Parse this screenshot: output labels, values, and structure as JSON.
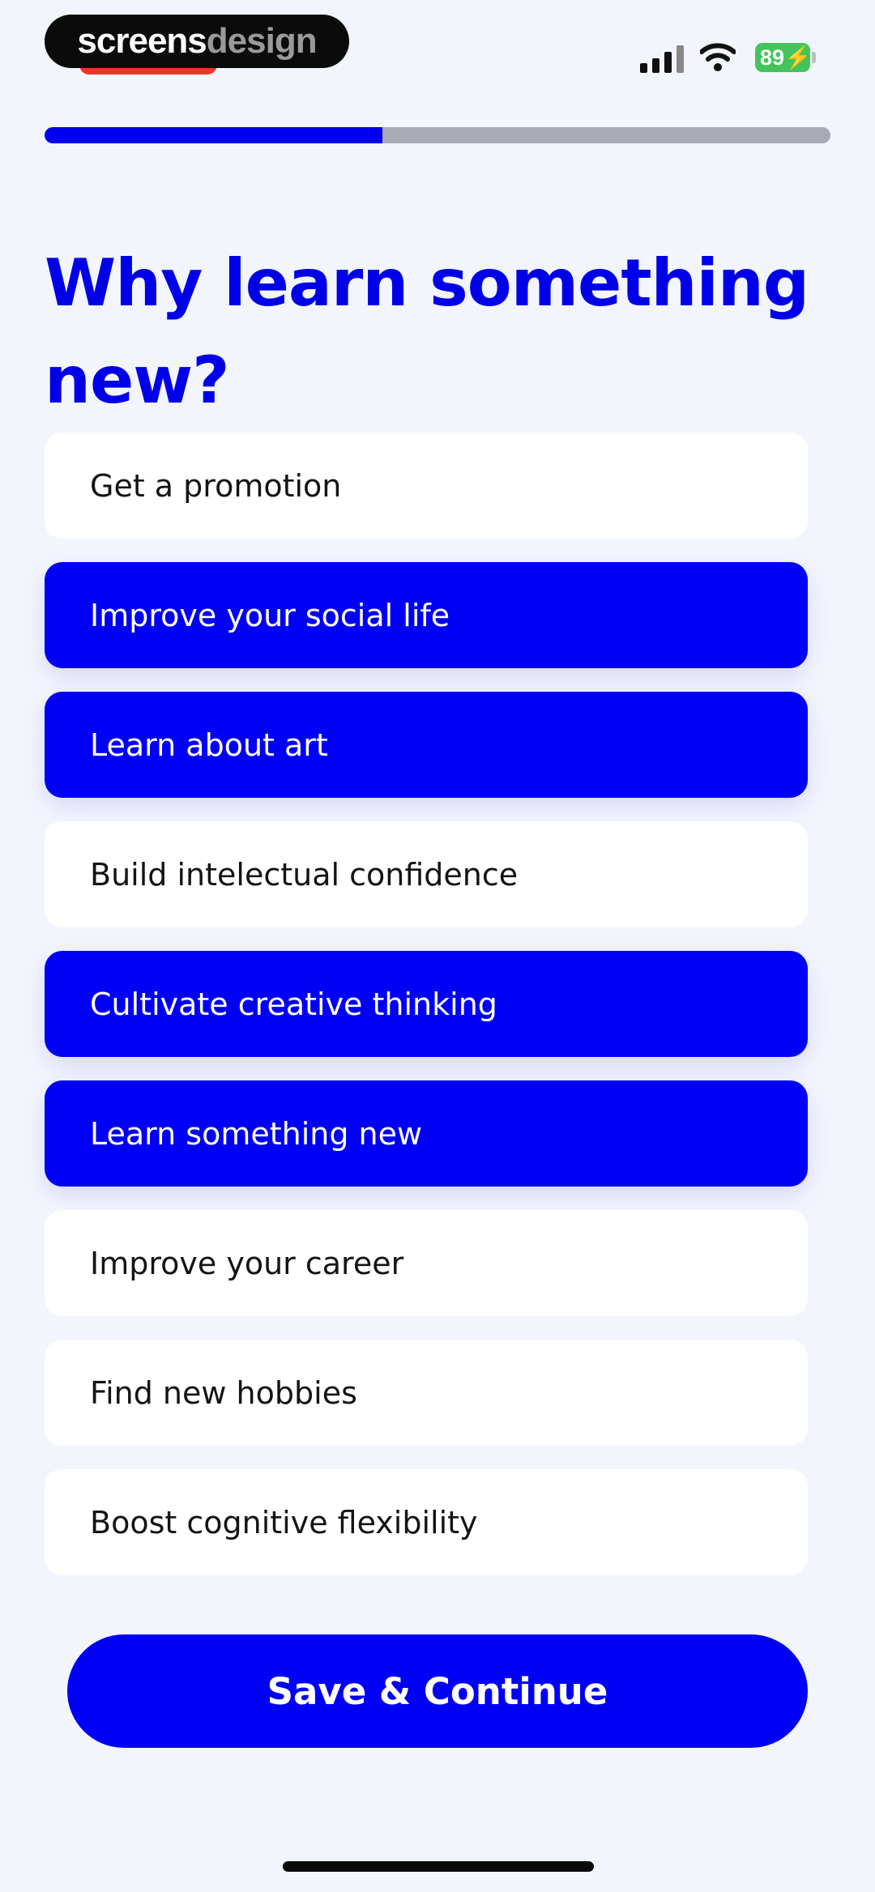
{
  "status_bar": {
    "brand_part1": "screens",
    "brand_part2": "design",
    "battery_level": "89"
  },
  "progress": {
    "value_percent": 43
  },
  "title": "Why learn something new?",
  "options": [
    {
      "label": "Get a promotion",
      "selected": false
    },
    {
      "label": "Improve your social life",
      "selected": true
    },
    {
      "label": "Learn about art",
      "selected": true
    },
    {
      "label": "Build intelectual confidence",
      "selected": false
    },
    {
      "label": "Cultivate creative thinking",
      "selected": true
    },
    {
      "label": "Learn something new",
      "selected": true
    },
    {
      "label": "Improve your career",
      "selected": false
    },
    {
      "label": "Find new hobbies",
      "selected": false
    },
    {
      "label": "Boost cognitive flexibility",
      "selected": false
    }
  ],
  "cta_label": "Save & Continue",
  "colors": {
    "accent": "#0000f5",
    "background": "#f3f5fd",
    "progress_track": "#a9abb4",
    "battery": "#43c45b"
  }
}
